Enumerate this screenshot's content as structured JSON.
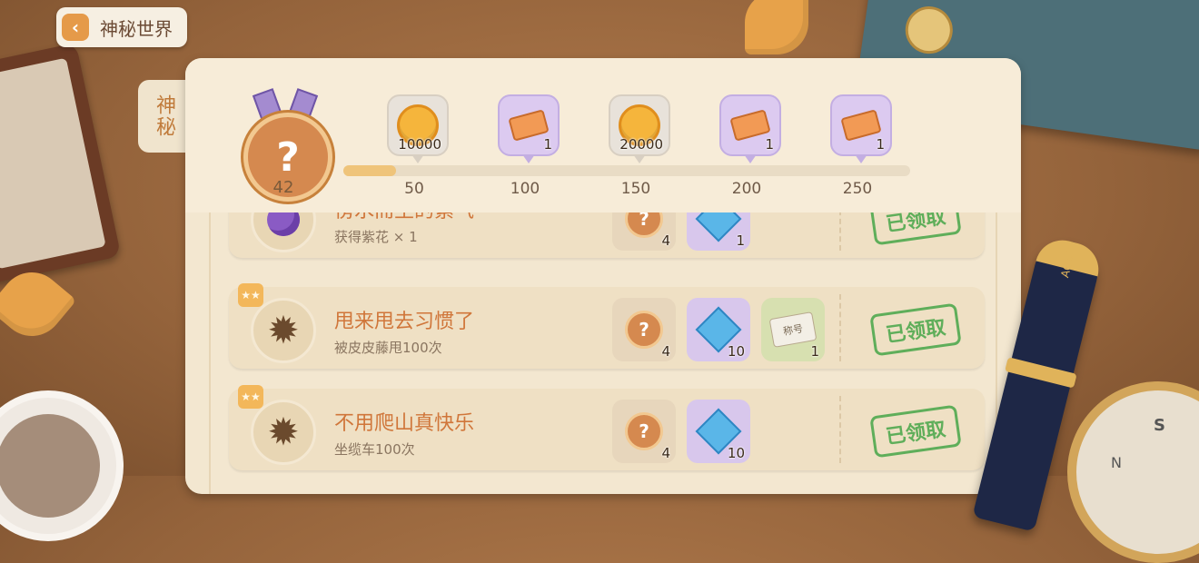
{
  "nav": {
    "back_label": "神秘世界"
  },
  "side_tab": {
    "label": "神秘"
  },
  "progress": {
    "current": 42,
    "max": 250,
    "milestones": [
      {
        "type": "coin",
        "amount": "10000",
        "threshold": "50"
      },
      {
        "type": "ticket",
        "amount": "1",
        "threshold": "100"
      },
      {
        "type": "coin",
        "amount": "20000",
        "threshold": "150"
      },
      {
        "type": "ticket",
        "amount": "1",
        "threshold": "200"
      },
      {
        "type": "ticket",
        "amount": "1",
        "threshold": "250"
      }
    ]
  },
  "tasks": [
    {
      "title": "傍水而生的紫气",
      "subtitle": "获得紫花 × 1",
      "icon": "purple-rose-icon",
      "rewards": [
        {
          "type": "medal",
          "amount": "4"
        },
        {
          "type": "gem",
          "amount": "1"
        }
      ],
      "status": "已领取"
    },
    {
      "title": "甩来甩去习惯了",
      "subtitle": "被皮皮藤甩100次",
      "icon": "sun-emblem-icon",
      "badge": "★★",
      "rewards": [
        {
          "type": "medal",
          "amount": "4"
        },
        {
          "type": "gem",
          "amount": "10"
        },
        {
          "type": "title-card",
          "amount": "1",
          "label": "称号"
        }
      ],
      "status": "已领取"
    },
    {
      "title": "不用爬山真快乐",
      "subtitle": "坐缆车100次",
      "icon": "sun-emblem-icon",
      "badge": "★★",
      "rewards": [
        {
          "type": "medal",
          "amount": "4"
        },
        {
          "type": "gem",
          "amount": "10"
        }
      ],
      "status": "已领取"
    }
  ],
  "decor": {
    "pen_brand": "AOBI",
    "compass_s": "S",
    "compass_n": "N"
  },
  "colors": {
    "accent": "#d0763a",
    "claimed_green": "#5fae5a",
    "progress_fill": "#efc47a"
  }
}
